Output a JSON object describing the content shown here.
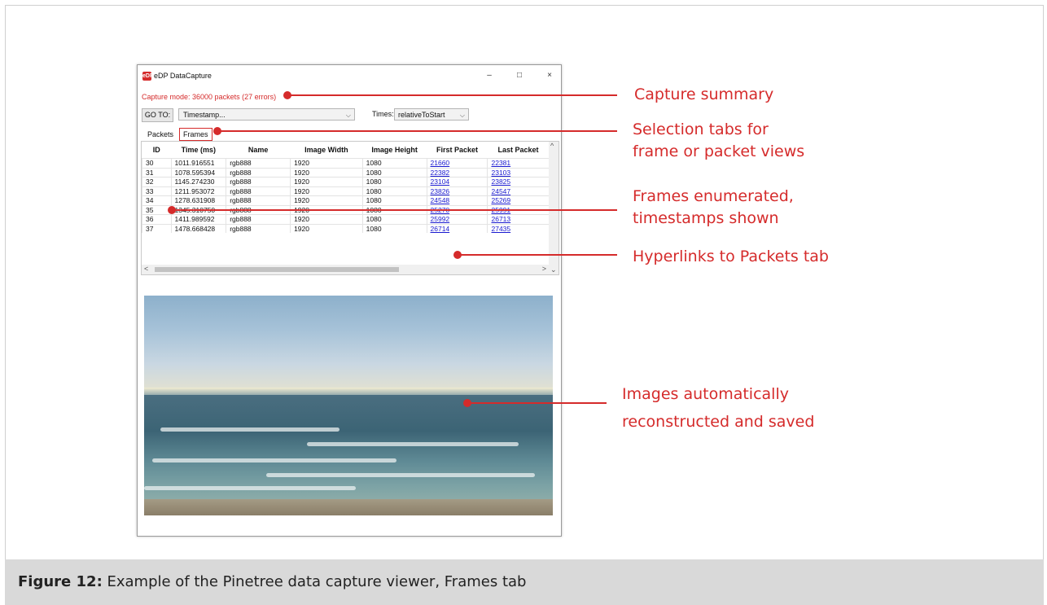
{
  "window": {
    "title": "eDP DataCapture",
    "icon_label": "eDP",
    "controls": {
      "minimize": "–",
      "maximize": "□",
      "close": "×"
    }
  },
  "capture_summary": "Capture mode: 36000 packets (27 errors)",
  "toolbar": {
    "goto_label": "GO TO:",
    "goto_value": "Timestamp...",
    "times_label": "Times:",
    "times_value": "relativeToStart"
  },
  "tabs": [
    {
      "label": "Packets",
      "active": false
    },
    {
      "label": "Frames",
      "active": true
    }
  ],
  "table": {
    "headers": [
      "ID",
      "Time (ms)",
      "Name",
      "Image Width",
      "Image Height",
      "First Packet",
      "Last Packet"
    ],
    "rows": [
      [
        "30",
        "1011.916551",
        "rgb888",
        "1920",
        "1080",
        "21660",
        "22381"
      ],
      [
        "31",
        "1078.595394",
        "rgb888",
        "1920",
        "1080",
        "22382",
        "23103"
      ],
      [
        "32",
        "1145.274230",
        "rgb888",
        "1920",
        "1080",
        "23104",
        "23825"
      ],
      [
        "33",
        "1211.953072",
        "rgb888",
        "1920",
        "1080",
        "23826",
        "24547"
      ],
      [
        "34",
        "1278.631908",
        "rgb888",
        "1920",
        "1080",
        "24548",
        "25269"
      ],
      [
        "35",
        "1345.310750",
        "rgb888",
        "1920",
        "1080",
        "25270",
        "25991"
      ],
      [
        "36",
        "1411.989592",
        "rgb888",
        "1920",
        "1080",
        "25992",
        "26713"
      ],
      [
        "37",
        "1478.668428",
        "rgb888",
        "1920",
        "1080",
        "26714",
        "27435"
      ]
    ]
  },
  "annotations": {
    "capture_summary": "Capture summary",
    "selection_tabs_1": "Selection tabs for",
    "selection_tabs_2": "frame or packet views",
    "frames_enum_1": "Frames enumerated,",
    "frames_enum_2": "timestamps shown",
    "hyperlinks": "Hyperlinks to Packets tab",
    "images_1": "Images automatically",
    "images_2": "reconstructed and saved"
  },
  "caption": {
    "label": "Figure 12:",
    "text": " Example of the Pinetree data capture viewer, Frames tab"
  },
  "colors": {
    "accent": "#d52b2b",
    "link": "#1a1ad0"
  }
}
